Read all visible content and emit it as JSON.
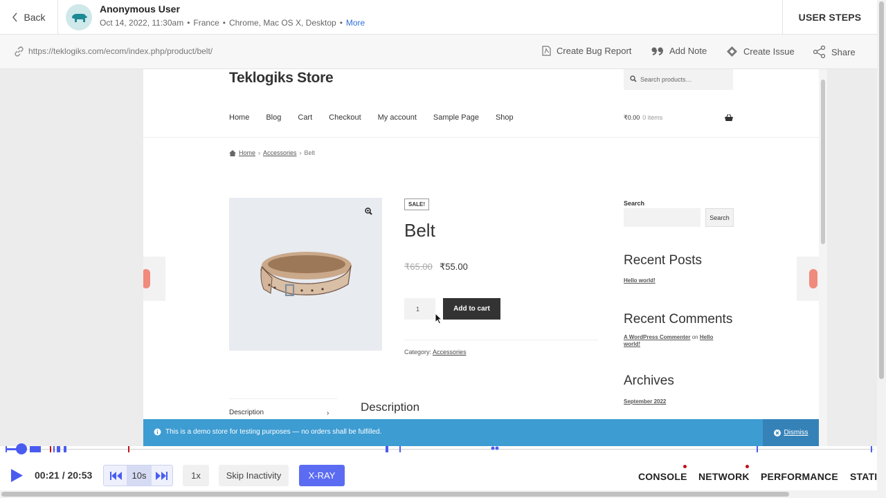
{
  "header": {
    "back_label": "Back",
    "user_name": "Anonymous User",
    "meta": {
      "datetime": "Oct 14, 2022, 11:30am",
      "country": "France",
      "env": "Chrome, Mac OS X, Desktop",
      "more": "More"
    },
    "user_steps": "USER STEPS"
  },
  "urlbar": {
    "url": "https://teklogiks.com/ecom/index.php/product/belt/",
    "actions": {
      "bug_report": "Create Bug Report",
      "add_note": "Add Note",
      "create_issue": "Create Issue",
      "share": "Share"
    }
  },
  "store": {
    "title": "Teklogiks Store",
    "search_placeholder": "Search products…",
    "nav": [
      "Home",
      "Blog",
      "Cart",
      "Checkout",
      "My account",
      "Sample Page",
      "Shop"
    ],
    "cart_total": "₹0.00",
    "cart_items": "0 items",
    "breadcrumb": {
      "home": "Home",
      "category": "Accessories",
      "current": "Belt"
    },
    "product": {
      "sale_badge": "SALE!",
      "title": "Belt",
      "price_old": "₹65.00",
      "price_new": "₹55.00",
      "quantity": "1",
      "add_to_cart": "Add to cart",
      "category_label": "Category:",
      "category": "Accessories"
    },
    "tabs": {
      "description_tab": "Description",
      "description_heading": "Description"
    },
    "sidebar": {
      "search_label": "Search",
      "search_button": "Search",
      "recent_posts_heading": "Recent Posts",
      "recent_post": "Hello world!",
      "recent_comments_heading": "Recent Comments",
      "comment_author": "A WordPress Commenter",
      "comment_on": "on",
      "comment_post": "Hello world!",
      "archives_heading": "Archives",
      "archive_month": "September 2022"
    },
    "notice": {
      "text": "This is a demo store for testing purposes — no orders shall be fulfilled.",
      "dismiss": "Dismiss"
    }
  },
  "player": {
    "time": "00:21 / 20:53",
    "seek_label": "10s",
    "speed": "1x",
    "skip_inactivity": "Skip Inactivity",
    "xray": "X-RAY",
    "progress_fraction": 0.017,
    "tabs": {
      "console": "CONSOLE",
      "network": "NETWORK",
      "performance": "PERFORMANCE",
      "stats": "STATI"
    }
  },
  "colors": {
    "accent": "#4a5cf0",
    "xray": "#5b6cf2",
    "notice": "#3d9cd2",
    "error_dot": "#c0101a",
    "link": "#2f6fd6"
  }
}
